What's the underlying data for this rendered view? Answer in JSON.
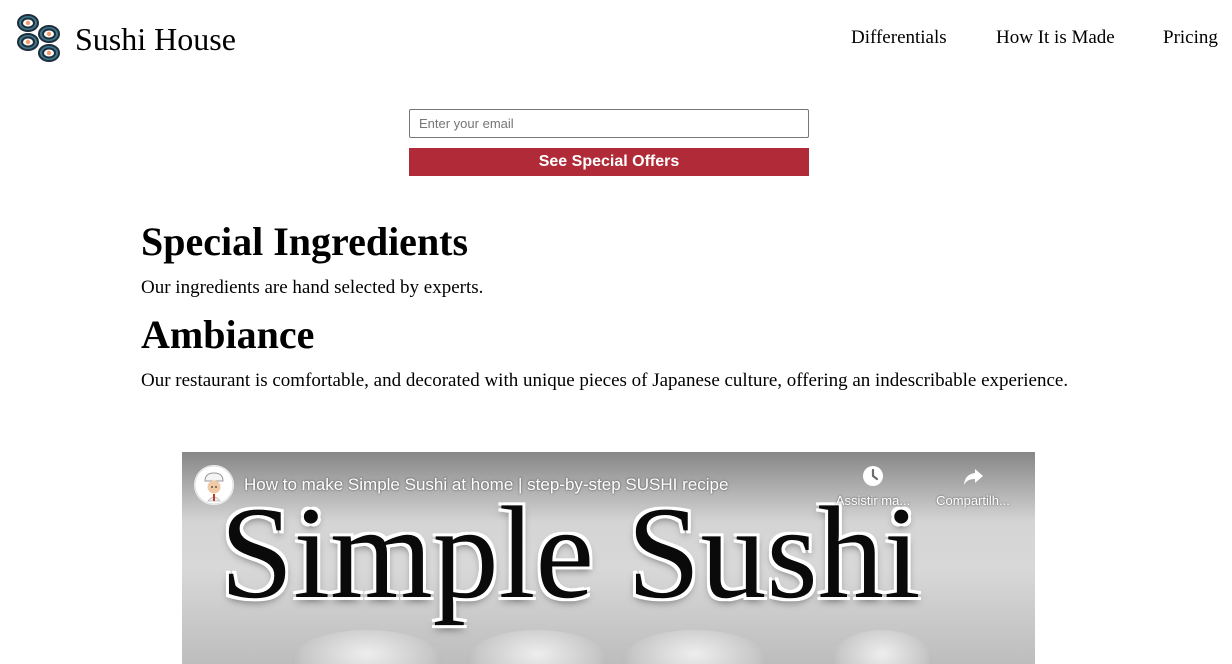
{
  "brand": {
    "name": "Sushi House",
    "logo_icon": "sushi-rolls-icon"
  },
  "nav": {
    "items": [
      {
        "label": "Differentials"
      },
      {
        "label": "How It is Made"
      },
      {
        "label": "Pricing"
      }
    ]
  },
  "form": {
    "email_placeholder": "Enter your email",
    "email_value": "",
    "submit_label": "See Special Offers",
    "accent_color": "#b02a37"
  },
  "sections": [
    {
      "title": "Special Ingredients",
      "text": "Our ingredients are hand selected by experts."
    },
    {
      "title": "Ambiance",
      "text": "Our restaurant is comfortable, and decorated with unique pieces of Japanese culture, offering an indescribable experience."
    }
  ],
  "video": {
    "title": "How to make Simple Sushi at home | step-by-step SUSHI recipe",
    "thumbnail_text": "Simple Sushi",
    "watch_later_label": "Assistir ma...",
    "share_label": "Compartilh...",
    "icons": {
      "watch_later": "clock-icon",
      "share": "share-arrow-icon",
      "channel": "chef-avatar-icon"
    }
  }
}
